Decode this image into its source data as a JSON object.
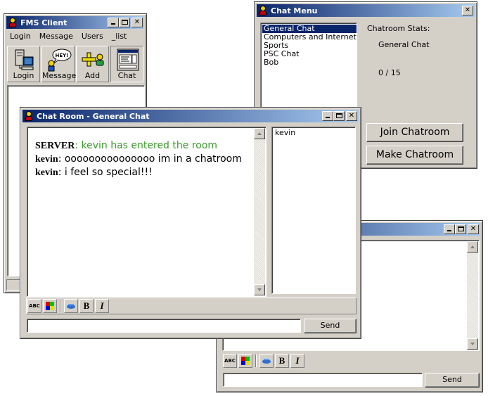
{
  "colors": {
    "titlebar_start": "#0a246a",
    "titlebar_end": "#a6caf0",
    "window_face": "#d4d0c8",
    "server_message": "#3a9a2a",
    "list_selection": "#0a246a"
  },
  "fms_client": {
    "title": "FMS Client",
    "menu": [
      "Login",
      "Message",
      "Users",
      "_list"
    ],
    "toolbar": [
      {
        "label": "Login",
        "icon": "computer-icon"
      },
      {
        "label": "Message",
        "icon": "hey-bubble-icon",
        "bubble": "HEY!"
      },
      {
        "label": "Add",
        "icon": "add-user-icon"
      },
      {
        "label": "Chat",
        "icon": "chat-window-icon"
      }
    ]
  },
  "chat_menu": {
    "title": "Chat Menu",
    "rooms": [
      "General Chat",
      "Computers and Internet",
      "Sports",
      "PSC Chat",
      "Bob"
    ],
    "selected_room": "General Chat",
    "stats_label": "Chatroom Stats:",
    "stats_room": "General Chat",
    "stats_count": "0 / 15",
    "join_button": "Join Chatroom",
    "make_button": "Make Chatroom"
  },
  "chat_room": {
    "title": "Chat Room - General Chat",
    "messages": [
      {
        "sender": "SERVER",
        "separator": ": ",
        "text": "kevin has entered the room",
        "kind": "server"
      },
      {
        "sender": "kevin",
        "separator": ": ",
        "text": "ooooooooooooooo im in a chatroom",
        "kind": "user"
      },
      {
        "sender": "kevin",
        "separator": ": ",
        "text": "i feel so special!!!",
        "kind": "user"
      }
    ],
    "users": [
      "kevin"
    ],
    "format_buttons": [
      {
        "name": "spellcheck-icon",
        "glyph": "ABC"
      },
      {
        "name": "color-palette-icon",
        "glyph": ""
      },
      {
        "name": "emoticon-icon",
        "glyph": ""
      },
      {
        "name": "bold-icon",
        "glyph": "B"
      },
      {
        "name": "italic-icon",
        "glyph": "I"
      }
    ],
    "input_value": "",
    "send_button": "Send"
  },
  "background_chat": {
    "send_button": "Send",
    "input_value": ""
  }
}
